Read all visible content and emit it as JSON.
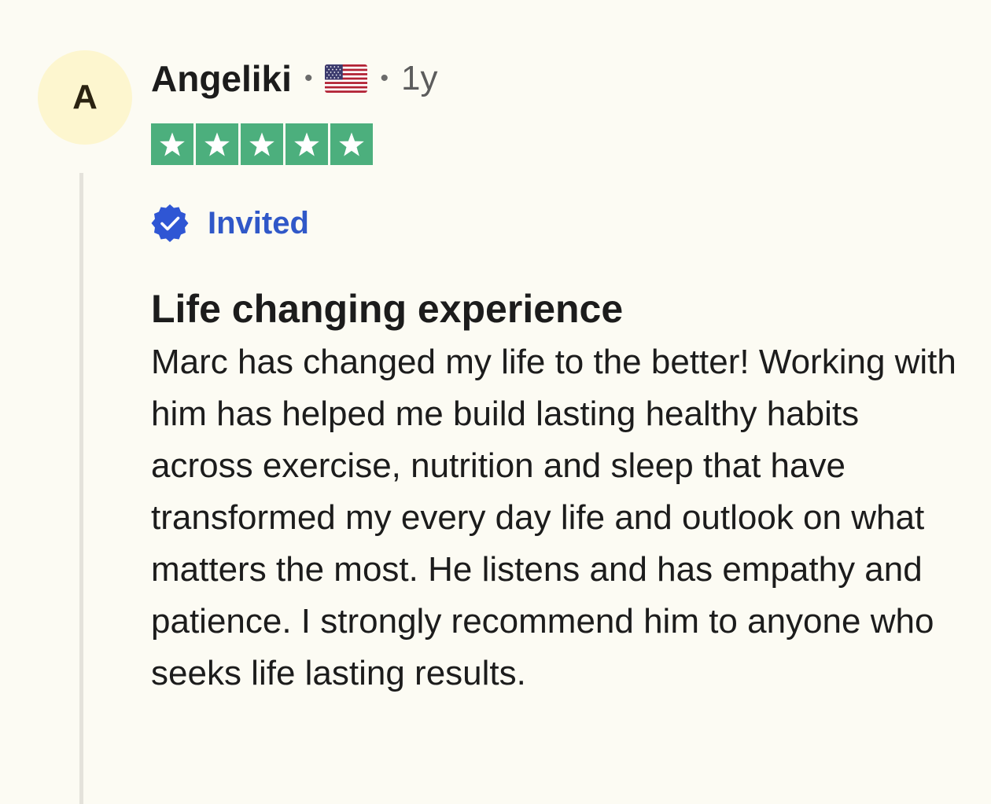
{
  "review": {
    "avatar_initial": "A",
    "reviewer_name": "Angeliki",
    "separator": "•",
    "country_flag_icon": "us-flag-icon",
    "age": "1y",
    "rating": 5,
    "rating_max": 5,
    "star_color": "#4caf7d",
    "badge": {
      "icon": "verified-badge-icon",
      "label": "Invited",
      "color": "#3058c8"
    },
    "title": "Life changing experience",
    "body": "Marc has changed my life to the better! Working with him has helped me build lasting healthy habits across exercise, nutrition and sleep that have transformed my every day life and outlook on what matters the most. He listens and has empathy and patience. I strongly recommend him to anyone who seeks life lasting results."
  }
}
